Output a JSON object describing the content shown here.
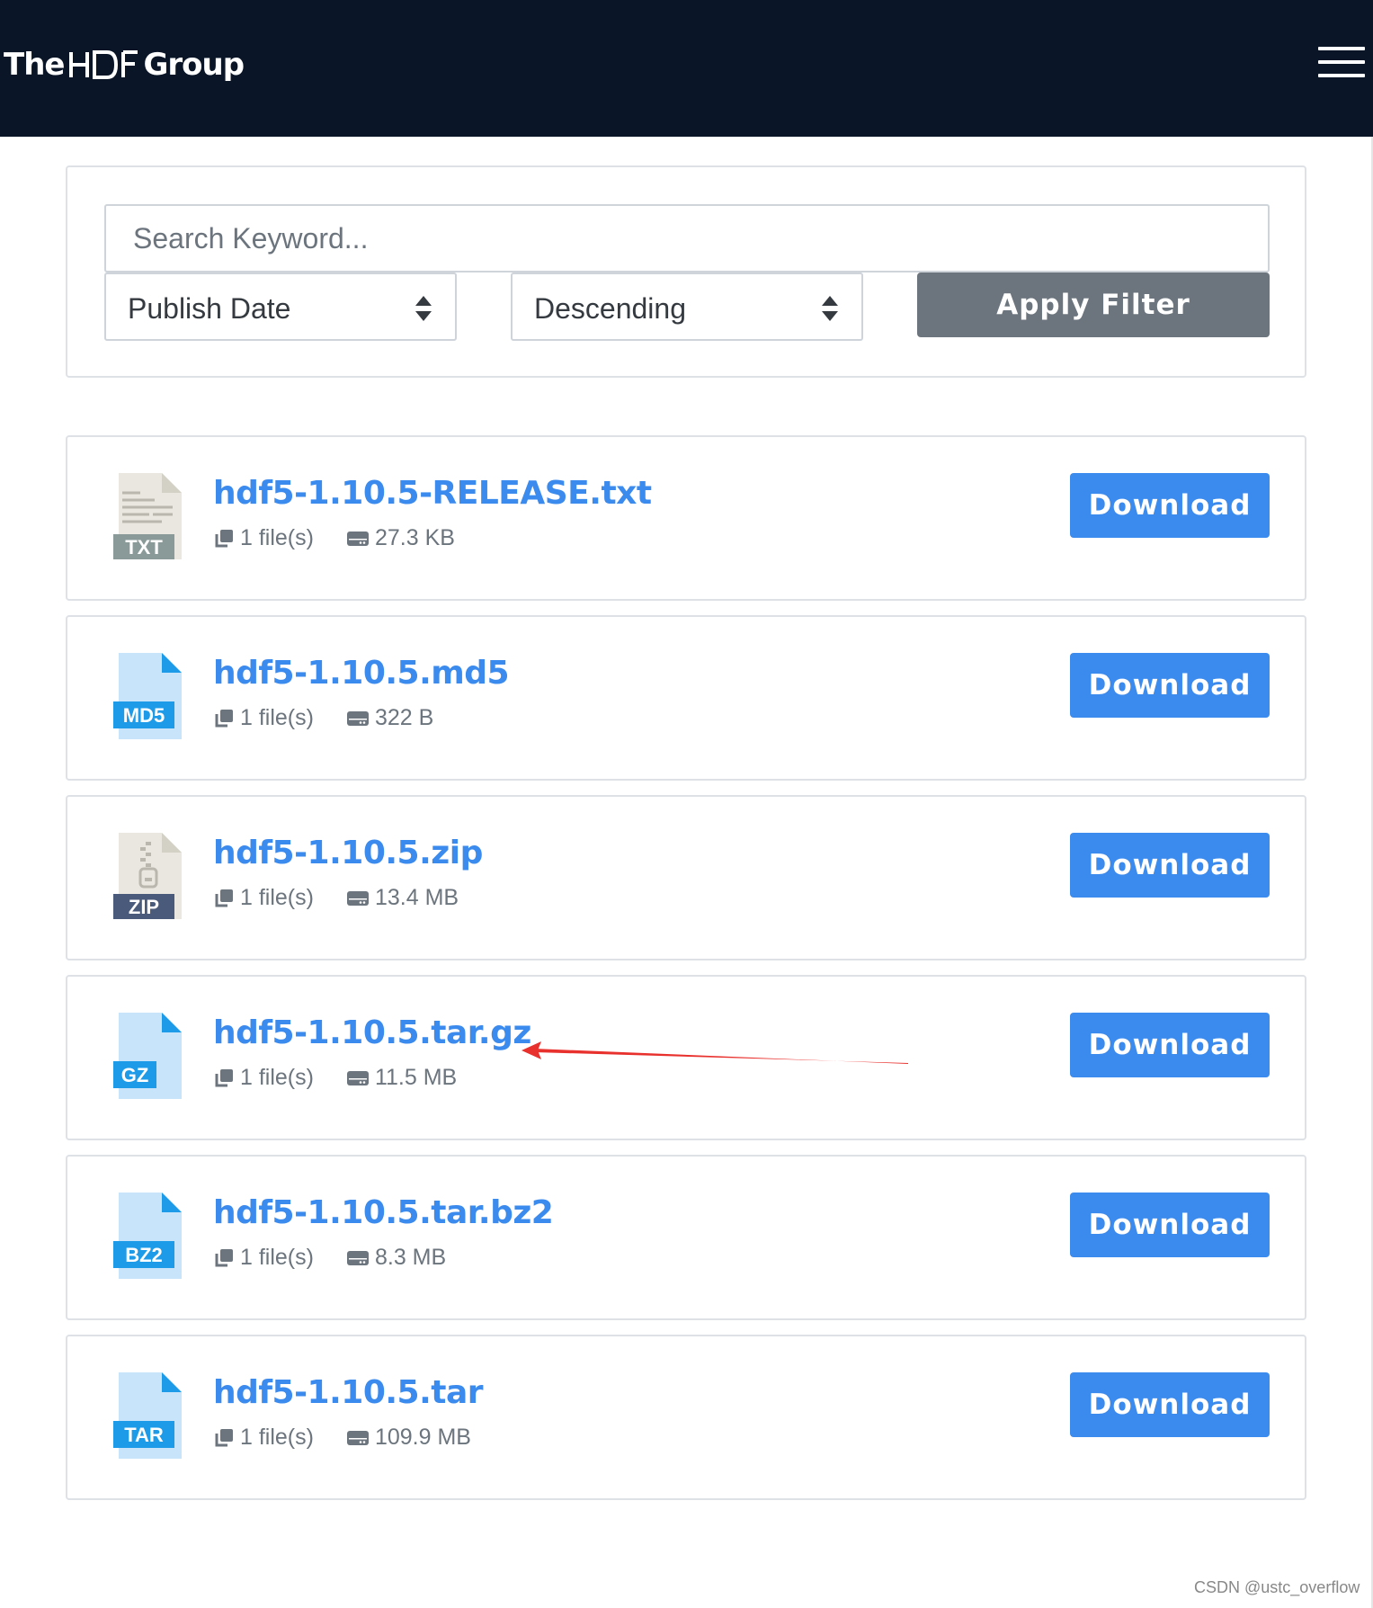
{
  "header": {
    "logo_the": "The",
    "logo_hdf": "HDF",
    "logo_group": "Group",
    "menu_icon": "hamburger-menu-icon"
  },
  "filter": {
    "search_placeholder": "Search Keyword...",
    "sort_by": "Publish Date",
    "order": "Descending",
    "apply_label": "Apply Filter"
  },
  "files": [
    {
      "name": "hdf5-1.10.5-RELEASE.txt",
      "badge": "TXT",
      "file_count": "1 file(s)",
      "size": "27.3 KB",
      "download_label": "Download",
      "icon": "txt-file-icon",
      "badge_color": "#8a9a98"
    },
    {
      "name": "hdf5-1.10.5.md5",
      "badge": "MD5",
      "file_count": "1 file(s)",
      "size": "322 B",
      "download_label": "Download",
      "icon": "md5-file-icon",
      "badge_color": "#1e9be8"
    },
    {
      "name": "hdf5-1.10.5.zip",
      "badge": "ZIP",
      "file_count": "1 file(s)",
      "size": "13.4 MB",
      "download_label": "Download",
      "icon": "zip-file-icon",
      "badge_color": "#4a5a7a"
    },
    {
      "name": "hdf5-1.10.5.tar.gz",
      "badge": "GZ",
      "file_count": "1 file(s)",
      "size": "11.5 MB",
      "download_label": "Download",
      "icon": "gz-file-icon",
      "badge_color": "#1e9be8"
    },
    {
      "name": "hdf5-1.10.5.tar.bz2",
      "badge": "BZ2",
      "file_count": "1 file(s)",
      "size": "8.3 MB",
      "download_label": "Download",
      "icon": "bz2-file-icon",
      "badge_color": "#1e9be8"
    },
    {
      "name": "hdf5-1.10.5.tar",
      "badge": "TAR",
      "file_count": "1 file(s)",
      "size": "109.9 MB",
      "download_label": "Download",
      "icon": "tar-file-icon",
      "badge_color": "#1e9be8"
    }
  ],
  "watermark": "CSDN @ustc_overflow",
  "colors": {
    "header_bg": "#0a1628",
    "link": "#3b8aed",
    "download_button": "#3b8aed",
    "apply_button": "#6c757d",
    "annotation_arrow": "#e8302c"
  }
}
